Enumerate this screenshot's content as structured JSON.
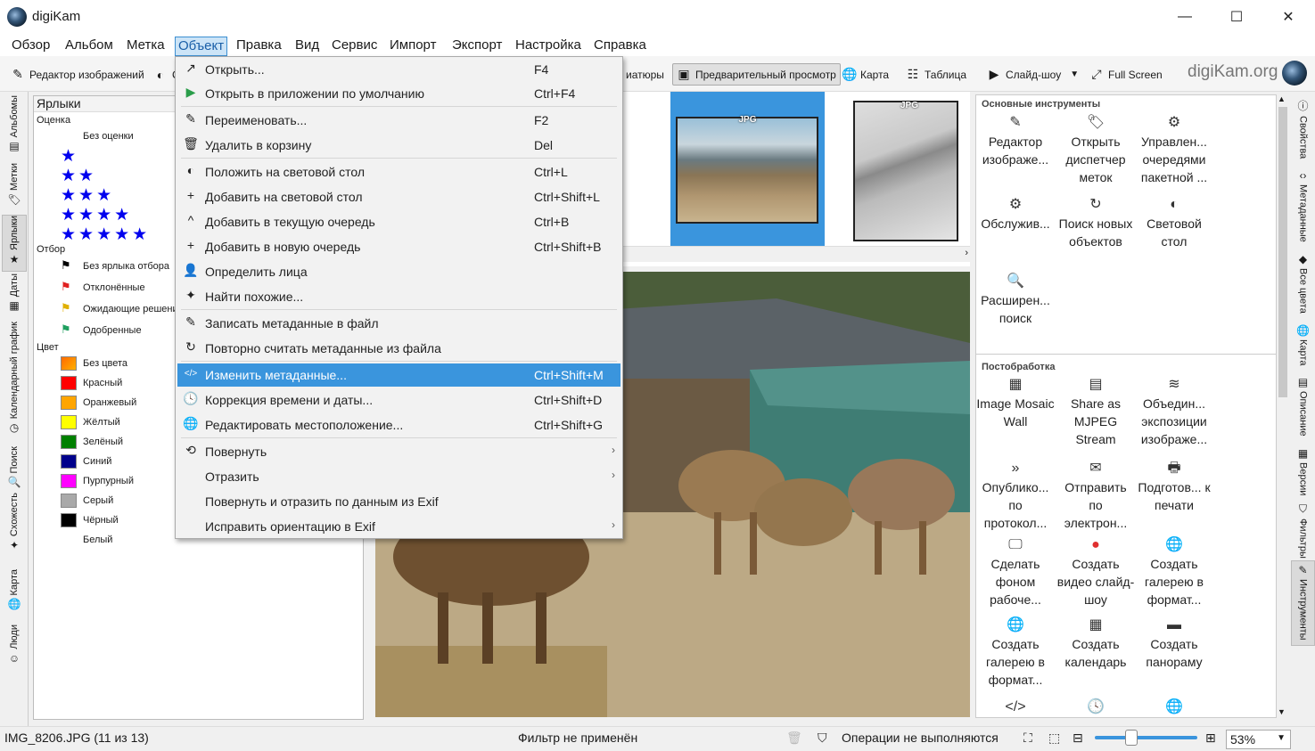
{
  "window": {
    "title": "digiKam",
    "min": "—",
    "max": "☐",
    "close": "✕"
  },
  "menubar": [
    "Обзор",
    "Альбом",
    "Метка",
    "Объект",
    "Правка",
    "Вид",
    "Сервис",
    "Импорт",
    "Экспорт",
    "Настройка",
    "Справка"
  ],
  "toolbar": {
    "editor": "Редактор изображений",
    "lighttable_partial": "С",
    "thumbnails_partial": "иатюры",
    "preview": "Предварительный просмотр",
    "map": "Карта",
    "table": "Таблица",
    "slideshow": "Слайд-шоу",
    "fullscreen": "Full Screen",
    "brand": "digiKam.org"
  },
  "left_tabs": [
    "Альбомы",
    "Метки",
    "Ярлыки",
    "Даты",
    "Календарный график",
    "Поиск",
    "Схожесть",
    "Карта",
    "Люди"
  ],
  "right_tabs": [
    "Свойства",
    "Метаданные",
    "Все цвета",
    "Карта",
    "Описание",
    "Версии",
    "Фильтры",
    "Инструменты"
  ],
  "labels_panel": {
    "title": "Ярлыки",
    "rating_section": "Оценка",
    "no_rating": "Без оценки",
    "pick_section": "Отбор",
    "picks": [
      "Без ярлыка отбора",
      "Отклонённые",
      "Ожидающие решения",
      "Одобренные"
    ],
    "color_section": "Цвет",
    "colors": [
      {
        "name": "Без цвета",
        "hex": "#ff8800"
      },
      {
        "name": "Красный",
        "hex": "#ff0000"
      },
      {
        "name": "Оранжевый",
        "hex": "#ffa500"
      },
      {
        "name": "Жёлтый",
        "hex": "#ffff00"
      },
      {
        "name": "Зелёный",
        "hex": "#008000"
      },
      {
        "name": "Синий",
        "hex": "#00008b"
      },
      {
        "name": "Пурпурный",
        "hex": "#ff00ff"
      },
      {
        "name": "Серый",
        "hex": "#a9a9a9"
      },
      {
        "name": "Чёрный",
        "hex": "#000000"
      },
      {
        "name": "Белый",
        "hex": "#ffffff"
      }
    ]
  },
  "thumbnails": {
    "tag": "JPG"
  },
  "context_menu": [
    {
      "icon": "open-icon",
      "glyph": "↗",
      "label": "Открыть...",
      "shortcut": "F4"
    },
    {
      "icon": "open-default-app-icon",
      "glyph": "▶",
      "label": "Открыть в приложении по умолчанию",
      "shortcut": "Ctrl+F4"
    },
    {
      "icon": "rename-icon",
      "glyph": "✎",
      "label": "Переименовать...",
      "shortcut": "F2"
    },
    {
      "icon": "trash-icon",
      "glyph": "🗑",
      "label": "Удалить в корзину",
      "shortcut": "Del"
    },
    {
      "icon": "lighttable-icon",
      "glyph": "◐",
      "label": "Положить на световой стол",
      "shortcut": "Ctrl+L"
    },
    {
      "icon": "add-icon",
      "glyph": "+",
      "label": "Добавить на световой стол",
      "shortcut": "Ctrl+Shift+L"
    },
    {
      "icon": "queue-icon",
      "glyph": "^",
      "label": "Добавить в текущую очередь",
      "shortcut": "Ctrl+B"
    },
    {
      "icon": "add-icon",
      "glyph": "+",
      "label": "Добавить в новую очередь",
      "shortcut": "Ctrl+Shift+B"
    },
    {
      "icon": "face-icon",
      "glyph": "👤",
      "label": "Определить лица",
      "shortcut": ""
    },
    {
      "icon": "magic-wand-icon",
      "glyph": "✦",
      "label": "Найти похожие...",
      "shortcut": ""
    },
    {
      "icon": "write-icon",
      "glyph": "✎",
      "label": "Записать метаданные в файл",
      "shortcut": ""
    },
    {
      "icon": "reload-icon",
      "glyph": "↻",
      "label": "Повторно считать метаданные из файла",
      "shortcut": ""
    },
    {
      "icon": "code-icon",
      "glyph": "</>",
      "label": "Изменить метаданные...",
      "shortcut": "Ctrl+Shift+M",
      "highlight": true
    },
    {
      "icon": "clock-icon",
      "glyph": "🕓",
      "label": "Коррекция времени и даты...",
      "shortcut": "Ctrl+Shift+D"
    },
    {
      "icon": "globe-icon",
      "glyph": "🌐",
      "label": "Редактировать местоположение...",
      "shortcut": "Ctrl+Shift+G"
    },
    {
      "icon": "rotate-icon",
      "glyph": "⟲",
      "label": "Повернуть",
      "shortcut": "",
      "submenu": true
    },
    {
      "icon": "",
      "glyph": "",
      "label": "Отразить",
      "shortcut": "",
      "submenu": true
    },
    {
      "icon": "",
      "glyph": "",
      "label": "Повернуть и отразить по данным из Exif",
      "shortcut": ""
    },
    {
      "icon": "",
      "glyph": "",
      "label": "Исправить ориентацию в Exif",
      "shortcut": "",
      "submenu": true
    }
  ],
  "tools_panel": {
    "section_main": "Основные инструменты",
    "main_tools": [
      {
        "icon": "✎",
        "label": "Редактор изображе..."
      },
      {
        "icon": "🏷",
        "label": "Открыть диспетчер меток"
      },
      {
        "icon": "⚙",
        "label": "Управлен... очередями пакетной ..."
      },
      {
        "icon": "⚙",
        "label": "Обслужив..."
      },
      {
        "icon": "↻",
        "label": "Поиск новых объектов"
      },
      {
        "icon": "◐",
        "label": "Световой стол"
      },
      {
        "icon": "🔍",
        "label": "Расширен... поиск"
      }
    ],
    "section_post": "Постобработка",
    "post_tools": [
      {
        "icon": "▦",
        "label": "Image Mosaic Wall"
      },
      {
        "icon": "▤",
        "label": "Share as MJPEG Stream"
      },
      {
        "icon": "≋",
        "label": "Объедин... экспозиции изображе..."
      },
      {
        "icon": "»",
        "label": "Опублико... по протокол..."
      },
      {
        "icon": "✉",
        "label": "Отправить по электрон..."
      },
      {
        "icon": "🖶",
        "label": "Подготов... к печати"
      },
      {
        "icon": "🖵",
        "label": "Сделать фоном рабоче..."
      },
      {
        "icon": "●",
        "label": "Создать видео слайд-шоу"
      },
      {
        "icon": "🌐",
        "label": "Создать галерею в формат..."
      },
      {
        "icon": "🌐",
        "label": "Создать галерею в формат..."
      },
      {
        "icon": "▦",
        "label": "Создать календарь"
      },
      {
        "icon": "▬",
        "label": "Создать панораму"
      },
      {
        "icon": "</>",
        "label": ""
      },
      {
        "icon": "🕓",
        "label": ""
      },
      {
        "icon": "🌐",
        "label": ""
      }
    ]
  },
  "status": {
    "file": "IMG_8206.JPG (11 из 13)",
    "filter": "Фильтр не применён",
    "ops": "Операции не выполняются",
    "zoom": "53%",
    "zoom_fraction": 0.42
  }
}
